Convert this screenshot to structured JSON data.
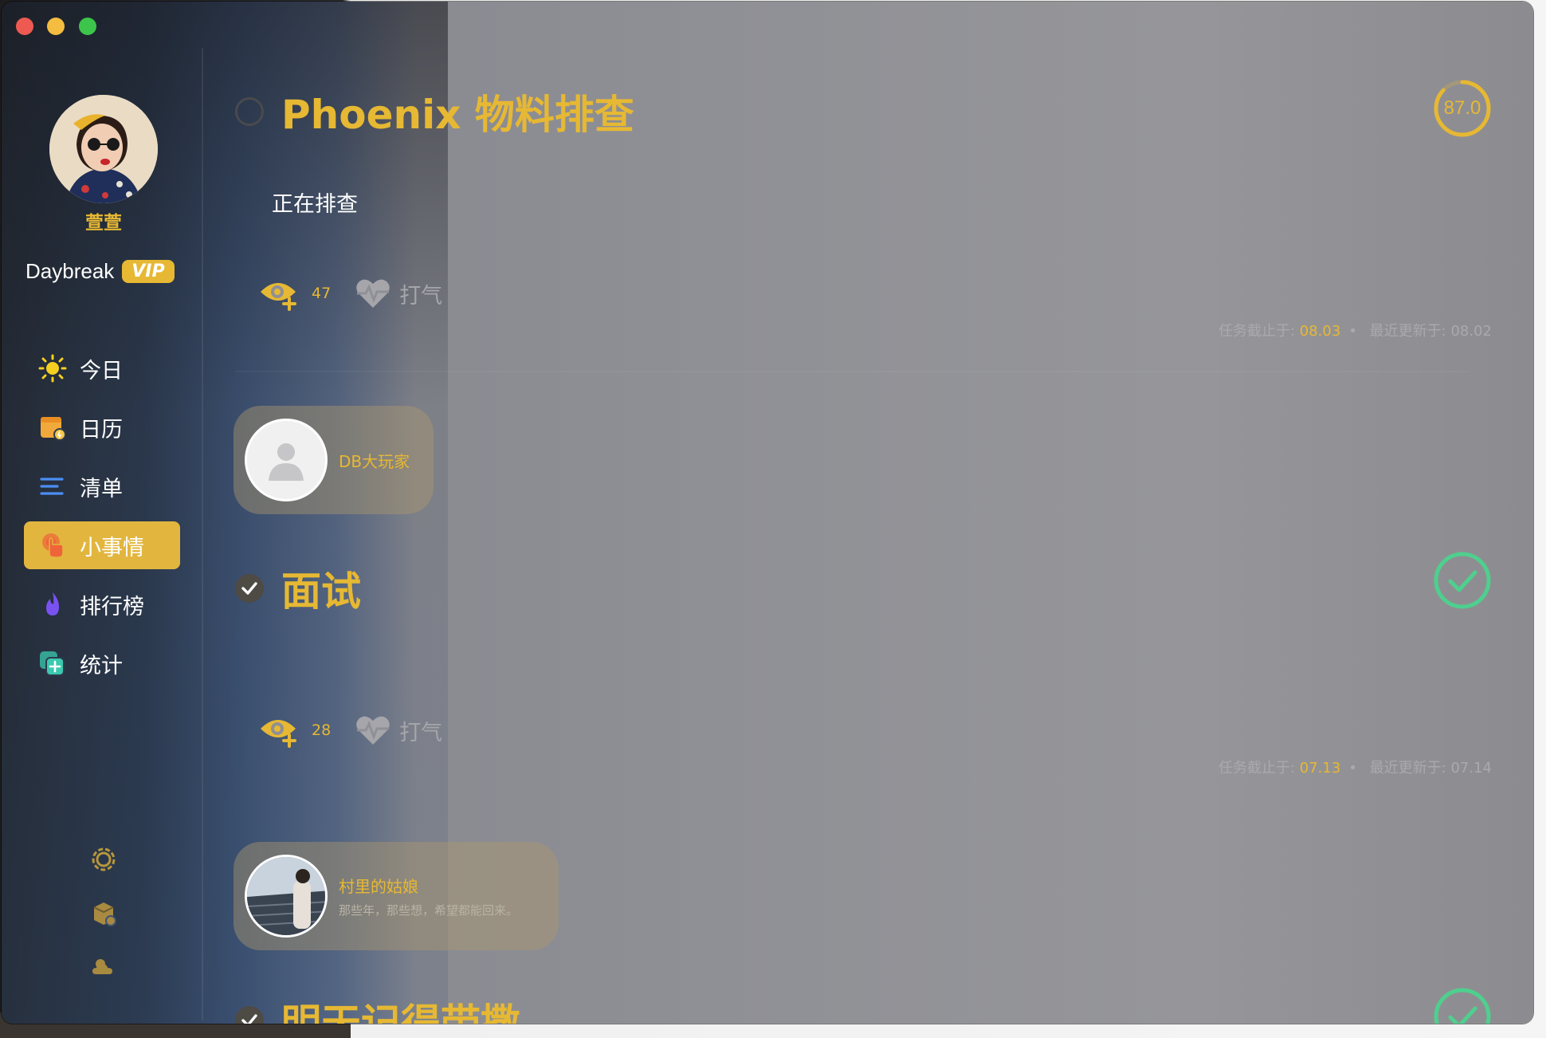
{
  "sidebar": {
    "username": "萱萱",
    "brand": "Daybreak",
    "vip": "VIP",
    "items": [
      {
        "label": "今日",
        "icon": "sun-icon"
      },
      {
        "label": "日历",
        "icon": "calendar-icon"
      },
      {
        "label": "清单",
        "icon": "list-icon"
      },
      {
        "label": "小事情",
        "icon": "finger-icon",
        "active": true
      },
      {
        "label": "排行榜",
        "icon": "flame-icon"
      },
      {
        "label": "统计",
        "icon": "stats-icon"
      }
    ],
    "footer_icons": [
      "gear-icon",
      "box-icon",
      "weather-icon"
    ]
  },
  "tasks": [
    {
      "title": "Phoenix 物料排查",
      "status": "open",
      "description": "正在排查",
      "score": "87.0",
      "score_progress": 0.87,
      "views": "47",
      "cheer_label": "打气",
      "deadline_label": "任务截止于:",
      "deadline": "08.03",
      "updated_label": "最近更新于:",
      "updated": "08.02",
      "user": {
        "name": "DB大玩家",
        "bio": ""
      }
    },
    {
      "title": "面试",
      "status": "done",
      "description": "",
      "views": "28",
      "cheer_label": "打气",
      "deadline_label": "任务截止于:",
      "deadline": "07.13",
      "updated_label": "最近更新于:",
      "updated": "07.14",
      "user": {
        "name": "村里的姑娘",
        "bio": "那些年，那些想，希望都能回来。"
      }
    },
    {
      "title": "明天记得带撒",
      "status": "done"
    }
  ],
  "colors": {
    "accent": "#e6b833",
    "done": "#4fcf8e"
  }
}
